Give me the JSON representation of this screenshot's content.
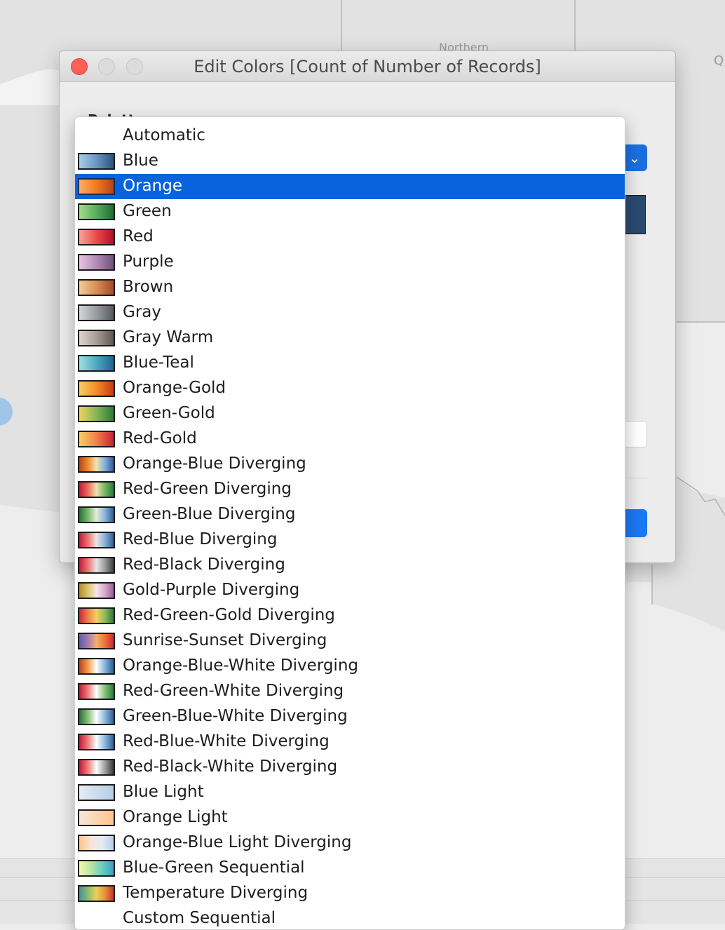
{
  "background": {
    "map_label": "Northern",
    "edge_label": "Q"
  },
  "dialog": {
    "title": "Edit Colors [Count of Number of Records]",
    "palette_label": "Palette:"
  },
  "menu": {
    "selected_index": 2,
    "items": [
      {
        "label": "Automatic",
        "gradient": null
      },
      {
        "label": "Blue",
        "gradient": [
          "#a9cce8",
          "#6a97c1",
          "#2d5380"
        ]
      },
      {
        "label": "Orange",
        "gradient": [
          "#fdae61",
          "#f07a1f",
          "#b8421a"
        ]
      },
      {
        "label": "Green",
        "gradient": [
          "#a6db8c",
          "#58ad5d",
          "#1e6b35"
        ]
      },
      {
        "label": "Red",
        "gradient": [
          "#fca39a",
          "#ec4a4a",
          "#b20e2a"
        ]
      },
      {
        "label": "Purple",
        "gradient": [
          "#e8c5e0",
          "#b28bb8",
          "#71517c"
        ]
      },
      {
        "label": "Brown",
        "gradient": [
          "#f0cd97",
          "#d98d56",
          "#a54b28"
        ]
      },
      {
        "label": "Gray",
        "gradient": [
          "#d4d6d8",
          "#979ca1",
          "#55595e"
        ]
      },
      {
        "label": "Gray Warm",
        "gradient": [
          "#ddd5d0",
          "#a89d96",
          "#5e5650"
        ]
      },
      {
        "label": "Blue-Teal",
        "gradient": [
          "#9ee0dc",
          "#4caac0",
          "#1f6394"
        ]
      },
      {
        "label": "Orange-Gold",
        "gradient": [
          "#fbcf61",
          "#f58b2c",
          "#c73b12"
        ]
      },
      {
        "label": "Green-Gold",
        "gradient": [
          "#f0d45c",
          "#87b656",
          "#2b7a3c"
        ]
      },
      {
        "label": "Red-Gold",
        "gradient": [
          "#fbcf61",
          "#f0804a",
          "#c7233a"
        ]
      },
      {
        "label": "Orange-Blue Diverging",
        "gradient": [
          "#b8421a",
          "#f08a2a",
          "#f5e3b0",
          "#7fb0dc",
          "#2d5c9a"
        ]
      },
      {
        "label": "Red-Green Diverging",
        "gradient": [
          "#c11a3a",
          "#ec6a5a",
          "#f0e0b0",
          "#70b860",
          "#2a7a38"
        ]
      },
      {
        "label": "Green-Blue Diverging",
        "gradient": [
          "#27703a",
          "#79b66a",
          "#e6ecd8",
          "#86b4d8",
          "#2f5e9a"
        ]
      },
      {
        "label": "Red-Blue Diverging",
        "gradient": [
          "#c11a3a",
          "#ee7070",
          "#efe4e4",
          "#86b0da",
          "#2f5e9a"
        ]
      },
      {
        "label": "Red-Black Diverging",
        "gradient": [
          "#c11a3a",
          "#ee7070",
          "#e8e4e4",
          "#9a9a9a",
          "#3e3e3e"
        ]
      },
      {
        "label": "Gold-Purple Diverging",
        "gradient": [
          "#ae8e2c",
          "#dcc46a",
          "#f2e8e6",
          "#d8a8cc",
          "#9a5e98"
        ]
      },
      {
        "label": "Red-Green-Gold Diverging",
        "gradient": [
          "#c9283a",
          "#f08048",
          "#f4d060",
          "#8cbc58",
          "#2d7a3c"
        ]
      },
      {
        "label": "Sunrise-Sunset Diverging",
        "gradient": [
          "#5b5ea8",
          "#a678b0",
          "#f2b070",
          "#f0703a",
          "#c92a3a"
        ]
      },
      {
        "label": "Orange-Blue-White Diverging",
        "gradient": [
          "#b8421a",
          "#f59a4a",
          "#ffffff",
          "#86b4dc",
          "#2d5c9a"
        ]
      },
      {
        "label": "Red-Green-White Diverging",
        "gradient": [
          "#c11a3a",
          "#f07a7a",
          "#ffffff",
          "#86c078",
          "#2a7a38"
        ]
      },
      {
        "label": "Green-Blue-White Diverging",
        "gradient": [
          "#27703a",
          "#86c078",
          "#ffffff",
          "#8ab8dc",
          "#2f5e9a"
        ]
      },
      {
        "label": "Red-Blue-White Diverging",
        "gradient": [
          "#c11a3a",
          "#f07a7a",
          "#ffffff",
          "#8ab8dc",
          "#2f5e9a"
        ]
      },
      {
        "label": "Red-Black-White Diverging",
        "gradient": [
          "#c11a3a",
          "#f07a7a",
          "#ffffff",
          "#a0a0a0",
          "#3a3a3a"
        ]
      },
      {
        "label": "Blue Light",
        "gradient": [
          "#e6ecf4",
          "#cddcef",
          "#b6cce8"
        ]
      },
      {
        "label": "Orange Light",
        "gradient": [
          "#f6e8dc",
          "#fcd5b0",
          "#ffc48c"
        ]
      },
      {
        "label": "Orange-Blue Light Diverging",
        "gradient": [
          "#ffc48c",
          "#f8e4d4",
          "#e4ecf4",
          "#b6cce8"
        ]
      },
      {
        "label": "Blue-Green Sequential",
        "gradient": [
          "#f6f9b0",
          "#b8e4a4",
          "#6cccc2",
          "#3aa0c0"
        ]
      },
      {
        "label": "Temperature Diverging",
        "gradient": [
          "#4a8fa0",
          "#8cbc6a",
          "#e8d05a",
          "#e8903a",
          "#c9342a"
        ]
      },
      {
        "label": "Custom Sequential",
        "gradient": null
      }
    ]
  }
}
